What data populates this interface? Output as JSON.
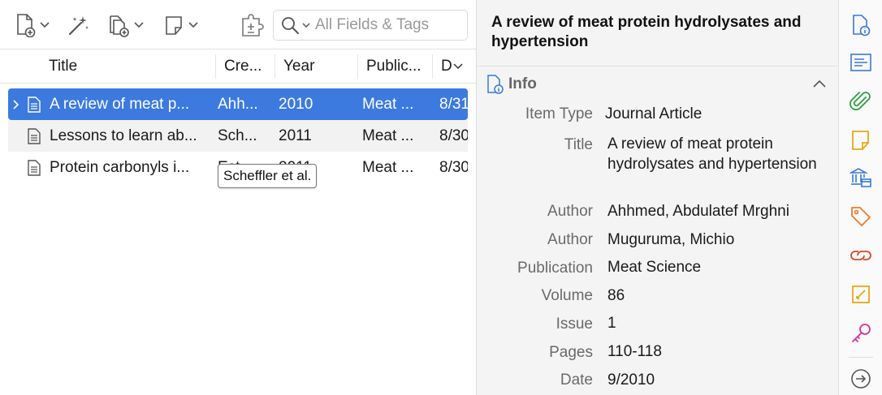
{
  "toolbar": {
    "search_placeholder": "All Fields & Tags"
  },
  "columns": {
    "title": "Title",
    "creator": "Cre...",
    "year": "Year",
    "publication": "Public...",
    "date_added": "D"
  },
  "rows": [
    {
      "title": "A review of meat p...",
      "creator": "Ahh...",
      "year": "2010",
      "publication": "Meat ...",
      "date": "8/31"
    },
    {
      "title": "Lessons to learn ab...",
      "creator": "Sch...",
      "year": "2011",
      "publication": "Meat ...",
      "date": "8/30"
    },
    {
      "title": "Protein carbonyls i...",
      "creator": "Est...",
      "year": "2011",
      "publication": "Meat ...",
      "date": "8/30"
    }
  ],
  "tooltip": "Scheffler et al.",
  "item_pane": {
    "title": "A review of meat protein hydrolysates and hypertension",
    "section": "Info",
    "fields": [
      {
        "label": "Item Type",
        "value": "Journal Article"
      },
      {
        "label": "Title",
        "value": "A review of meat protein hydrolysates and hypertension"
      },
      {
        "label": "Author",
        "value": "Ahhmed, Abdulatef Mrghni"
      },
      {
        "label": "Author",
        "value": "Muguruma, Michio"
      },
      {
        "label": "Publication",
        "value": "Meat Science"
      },
      {
        "label": "Volume",
        "value": "86"
      },
      {
        "label": "Issue",
        "value": "1"
      },
      {
        "label": "Pages",
        "value": "110-118"
      },
      {
        "label": "Date",
        "value": "9/2010"
      }
    ]
  },
  "colors": {
    "selection": "#3d7ae0",
    "nav_info": "#3b78d8",
    "nav_abstract": "#3b78d8",
    "nav_attachments": "#2e9e3e",
    "nav_notes": "#e6a817",
    "nav_libraries": "#3b78d8",
    "nav_tags": "#ef7a2a",
    "nav_related": "#d24a2a",
    "nav_annotations": "#e6a817",
    "nav_locate": "#d6309b"
  },
  "icons": {
    "new_item": "new-item-icon",
    "add_by_identifier": "magic-wand-icon",
    "new_collection": "new-attachment-icon",
    "new_note": "new-note-icon",
    "search": "search-icon",
    "sidenav": [
      "info-icon",
      "abstract-icon",
      "attachments-icon",
      "notes-icon",
      "libraries-icon",
      "tags-icon",
      "related-icon",
      "annotations-icon",
      "locate-icon",
      "collapse-pane-icon"
    ]
  }
}
